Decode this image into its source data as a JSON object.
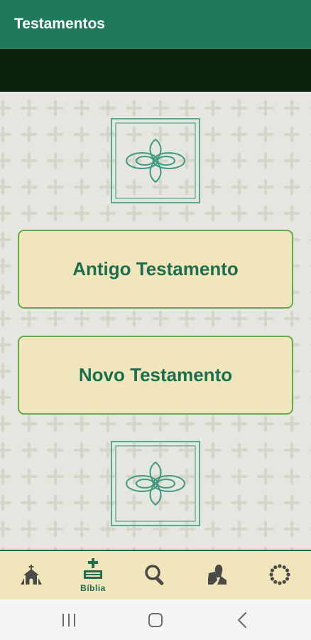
{
  "appbar": {
    "title": "Testamentos"
  },
  "main": {
    "buttons": [
      {
        "label": "Antigo Testamento"
      },
      {
        "label": "Novo Testamento"
      }
    ]
  },
  "bottom_nav": {
    "items": [
      {
        "icon": "church-icon",
        "label": "",
        "selected": false
      },
      {
        "icon": "bible-icon",
        "label": "Bíblia",
        "selected": true
      },
      {
        "icon": "search-icon",
        "label": "",
        "selected": false
      },
      {
        "icon": "praying-hands-icon",
        "label": "",
        "selected": false
      },
      {
        "icon": "rosary-icon",
        "label": "",
        "selected": false
      }
    ]
  },
  "system_nav": {
    "buttons": [
      {
        "icon": "recent-apps-icon"
      },
      {
        "icon": "home-icon"
      },
      {
        "icon": "back-icon"
      }
    ]
  },
  "colors": {
    "appbar": "#1e7a5a",
    "dark_bar": "#0b200b",
    "button_fill": "#f1e6bb",
    "button_border": "#63aa4c",
    "button_text": "#1c6e4e",
    "nav_icon": "#4a4a48"
  }
}
